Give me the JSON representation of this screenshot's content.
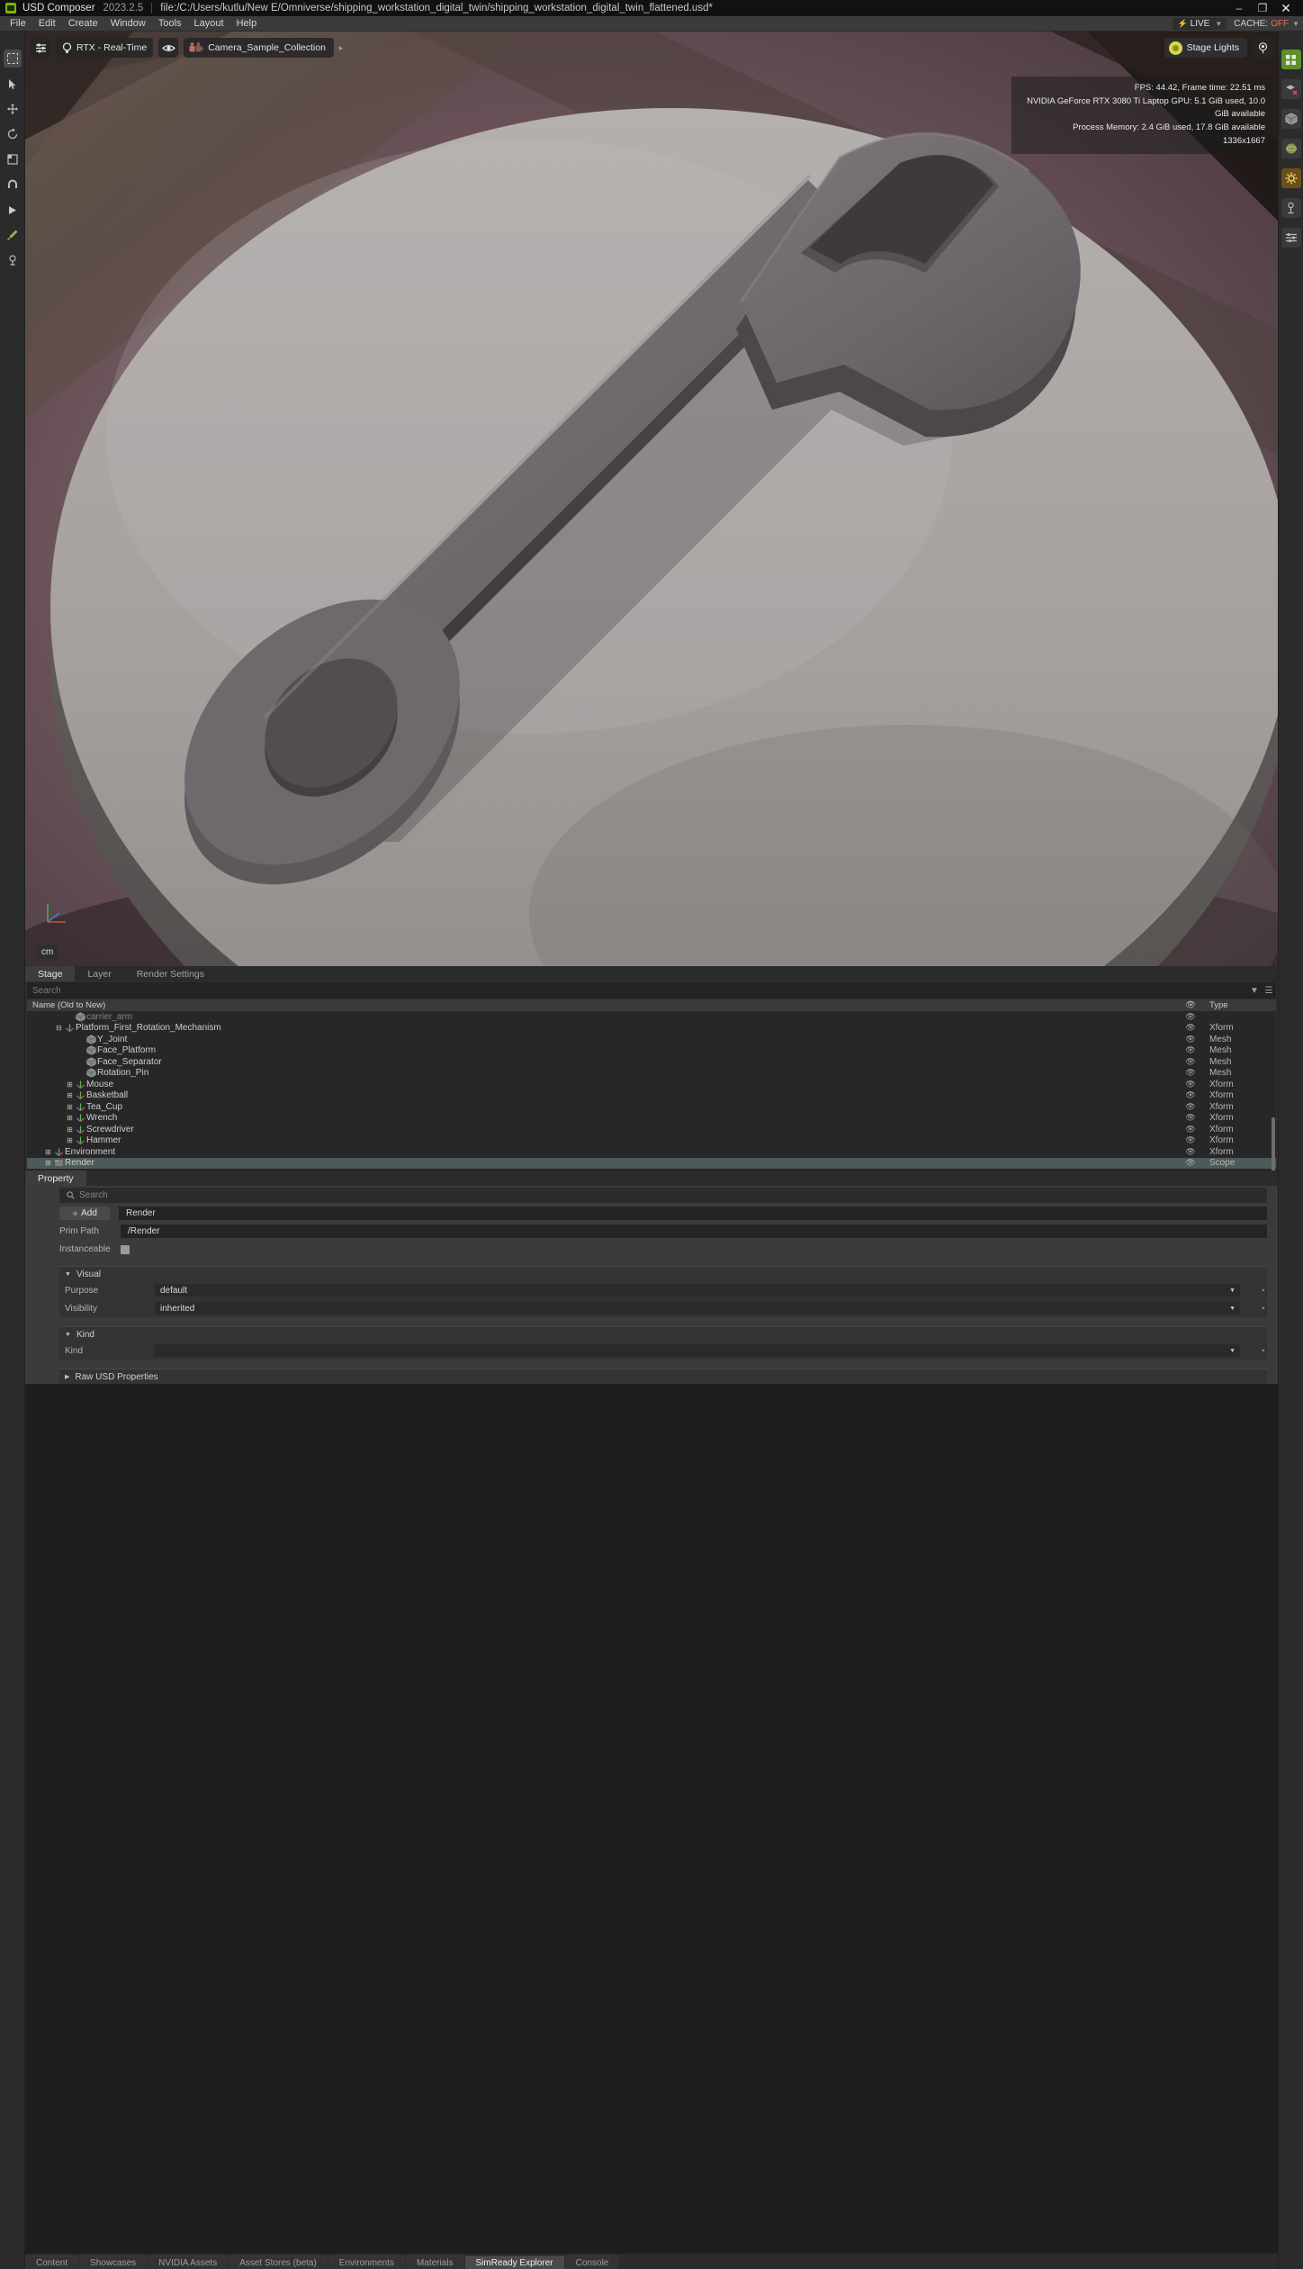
{
  "titlebar": {
    "app_name": "USD Composer",
    "version": "2023.2.5",
    "file_path": "file:/C:/Users/kutlu/New E/Omniverse/shipping_workstation_digital_twin/shipping_workstation_digital_twin_flattened.usd*",
    "minimize": "–",
    "maximize": "❐",
    "close": "✕"
  },
  "menubar": {
    "items": [
      "File",
      "Edit",
      "Create",
      "Window",
      "Tools",
      "Layout",
      "Help"
    ],
    "live_label": "LIVE",
    "cache_label": "CACHE:",
    "cache_value": "OFF"
  },
  "viewport": {
    "renderer": "RTX - Real-Time",
    "camera": "Camera_Sample_Collection",
    "stage_lights": "Stage Lights",
    "hud": {
      "line1": "FPS: 44.42, Frame time: 22.51 ms",
      "line2": "NVIDIA GeForce RTX 3080 Ti Laptop GPU: 5.1 GiB used, 10.0 GiB available",
      "line3": "Process Memory: 2.4 GiB used, 17.8 GiB available",
      "line4": "1336x1667"
    },
    "unit": "cm"
  },
  "stage": {
    "tabs": [
      {
        "label": "Stage",
        "active": true
      },
      {
        "label": "Layer",
        "active": false
      },
      {
        "label": "Render Settings",
        "active": false
      }
    ],
    "search_placeholder": "Search",
    "columns": {
      "name": "Name (Old to New)",
      "type": "Type"
    },
    "rows": [
      {
        "name": "carrier_arm",
        "type": "",
        "indent": 3,
        "expander": "",
        "icon": "mesh",
        "clipped": true,
        "selected": false
      },
      {
        "name": "Platform_First_Rotation_Mechanism",
        "type": "Xform",
        "indent": 2,
        "expander": "minus",
        "icon": "xform",
        "selected": false
      },
      {
        "name": "Y_Joint",
        "type": "Mesh",
        "indent": 4,
        "expander": "",
        "icon": "mesh",
        "selected": false
      },
      {
        "name": "Face_Platform",
        "type": "Mesh",
        "indent": 4,
        "expander": "",
        "icon": "mesh",
        "selected": false
      },
      {
        "name": "Face_Separator",
        "type": "Mesh",
        "indent": 4,
        "expander": "",
        "icon": "mesh",
        "selected": false
      },
      {
        "name": "Rotation_Pin",
        "type": "Mesh",
        "indent": 4,
        "expander": "",
        "icon": "mesh",
        "selected": false
      },
      {
        "name": "Mouse",
        "type": "Xform",
        "indent": 3,
        "expander": "plus",
        "icon": "xform",
        "selected": false
      },
      {
        "name": "Basketball",
        "type": "Xform",
        "indent": 3,
        "expander": "plus",
        "icon": "xform",
        "selected": false
      },
      {
        "name": "Tea_Cup",
        "type": "Xform",
        "indent": 3,
        "expander": "plus",
        "icon": "xform",
        "selected": false
      },
      {
        "name": "Wrench",
        "type": "Xform",
        "indent": 3,
        "expander": "plus",
        "icon": "xform",
        "selected": false
      },
      {
        "name": "Screwdriver",
        "type": "Xform",
        "indent": 3,
        "expander": "plus",
        "icon": "xform",
        "selected": false
      },
      {
        "name": "Hammer",
        "type": "Xform",
        "indent": 3,
        "expander": "plus",
        "icon": "xform",
        "selected": false
      },
      {
        "name": "Environment",
        "type": "Xform",
        "indent": 1,
        "expander": "plus",
        "icon": "xform",
        "selected": false
      },
      {
        "name": "Render",
        "type": "Scope",
        "indent": 1,
        "expander": "plus",
        "icon": "scope",
        "selected": true
      }
    ]
  },
  "property": {
    "tab_label": "Property",
    "search_placeholder": "Search",
    "add_label": "Add",
    "name_value": "Render",
    "prim_path_label": "Prim Path",
    "prim_path_value": "/Render",
    "instanceable_label": "Instanceable",
    "visual": {
      "title": "Visual",
      "purpose_label": "Purpose",
      "purpose_value": "default",
      "visibility_label": "Visibility",
      "visibility_value": "inherited"
    },
    "kind": {
      "title": "Kind",
      "kind_label": "Kind",
      "kind_value": ""
    },
    "raw_usd_properties": "Raw USD Properties"
  },
  "bottom_tabs": [
    {
      "label": "Content",
      "active": false
    },
    {
      "label": "Showcases",
      "active": false
    },
    {
      "label": "NVIDIA Assets",
      "active": false
    },
    {
      "label": "Asset Stores (beta)",
      "active": false
    },
    {
      "label": "Environments",
      "active": false
    },
    {
      "label": "Materials",
      "active": false
    },
    {
      "label": "SimReady Explorer",
      "active": true
    },
    {
      "label": "Console",
      "active": false
    }
  ],
  "colors": {
    "brand_green": "#76b900",
    "accent_red": "#e06c5a",
    "selection": "#4c5a5a",
    "panel_bg": "#2e2e2e"
  }
}
